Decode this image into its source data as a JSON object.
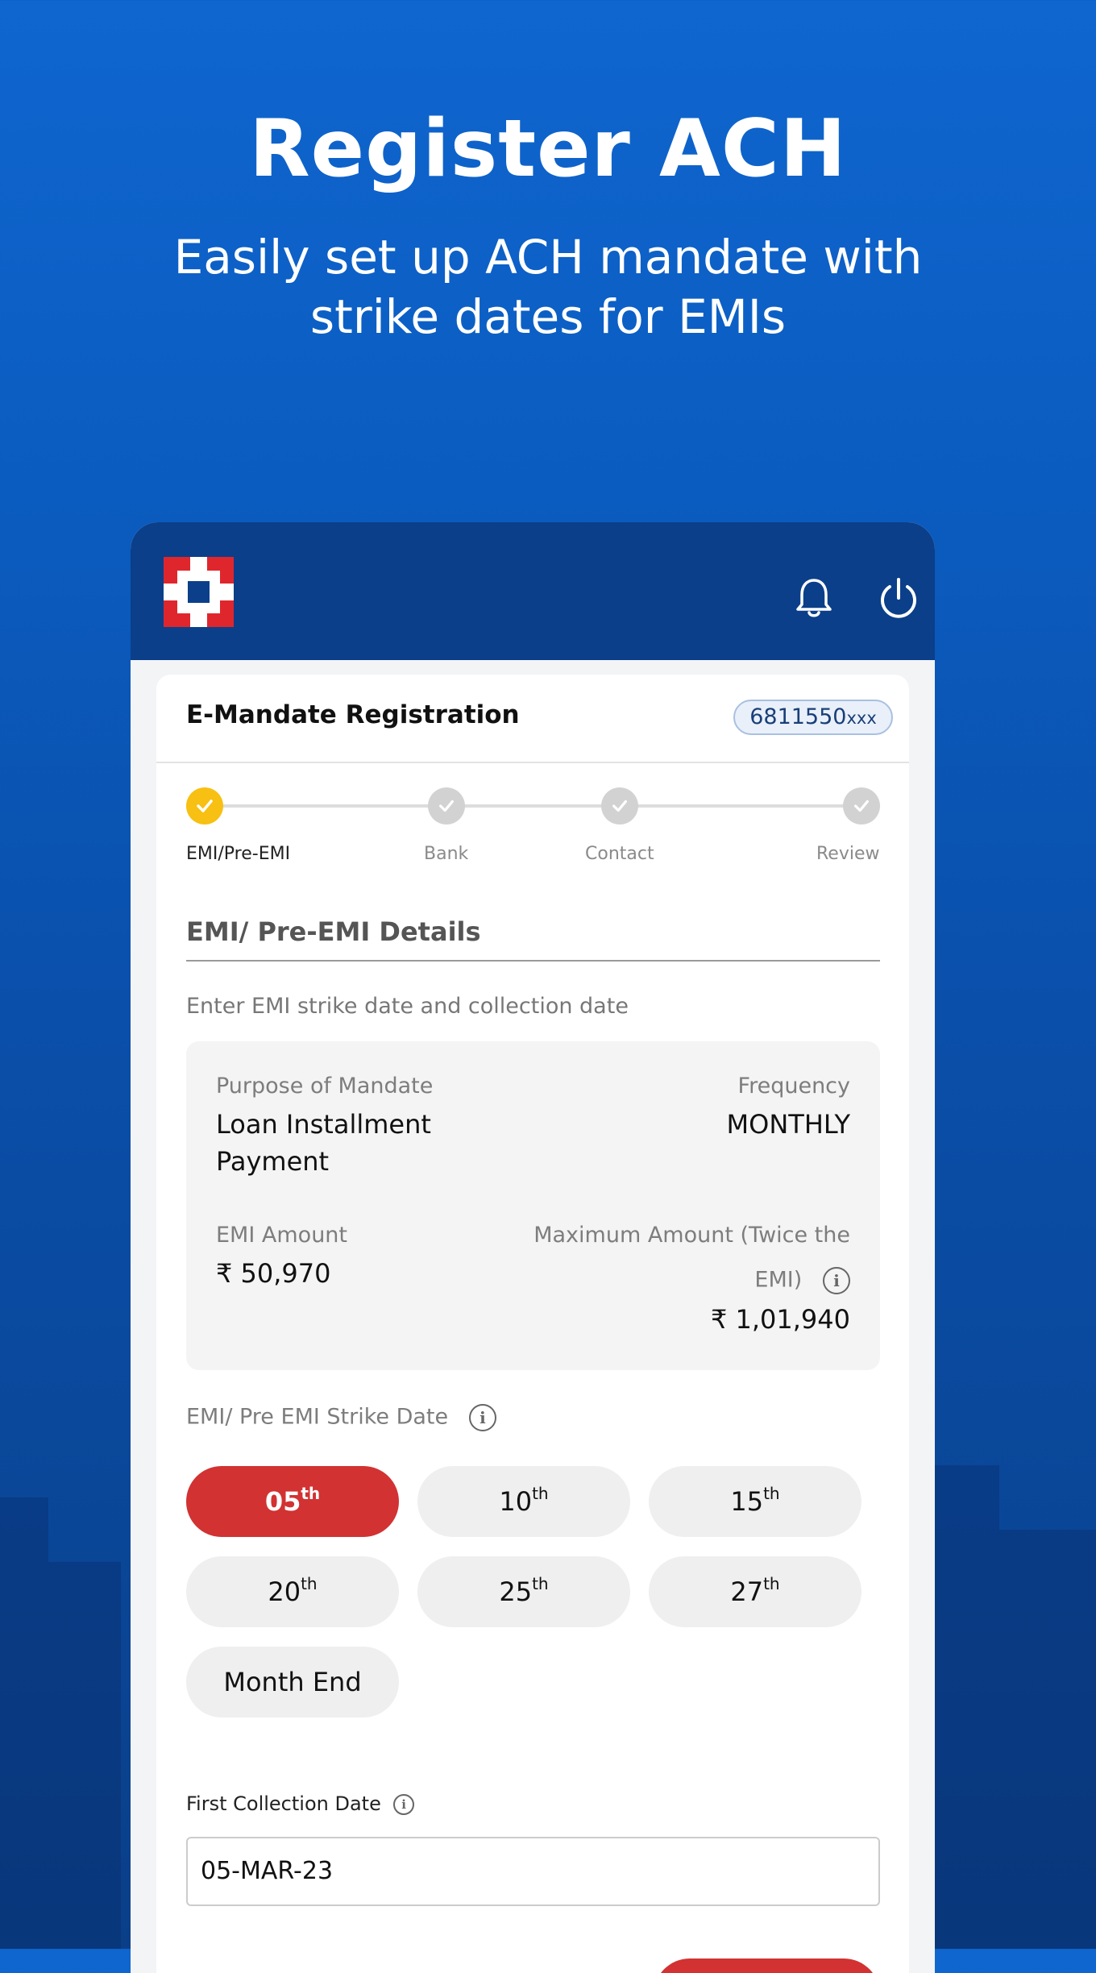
{
  "hero": {
    "title": "Register ACH",
    "subtitle": "Easily set up ACH mandate with strike dates for EMIs"
  },
  "colors": {
    "brand_blue": "#0b3f8a",
    "accent_red": "#d23232",
    "step_active": "#f7c012"
  },
  "header": {
    "icons": [
      "hdfc-logo",
      "bell-icon",
      "power-icon"
    ]
  },
  "card": {
    "title": "E-Mandate Registration",
    "account_main": "6811550",
    "account_suffix": "xxx"
  },
  "stepper": {
    "steps": [
      {
        "label": "EMI/Pre-EMI",
        "state": "active"
      },
      {
        "label": "Bank",
        "state": "done"
      },
      {
        "label": "Contact",
        "state": "done"
      },
      {
        "label": "Review",
        "state": "done"
      }
    ]
  },
  "section": {
    "title": "EMI/ Pre-EMI Details",
    "description": "Enter EMI strike date and collection date"
  },
  "details": {
    "purpose_label": "Purpose of Mandate",
    "purpose_value": "Loan Installment Payment",
    "frequency_label": "Frequency",
    "frequency_value": "MONTHLY",
    "emi_label": "EMI Amount",
    "emi_value": "₹ 50,970",
    "max_label_line1": "Maximum Amount (Twice the",
    "max_label_line2": "EMI)",
    "max_value": "₹ 1,01,940"
  },
  "strike": {
    "label": "EMI/ Pre EMI Strike Date",
    "options": [
      {
        "num": "05",
        "suffix": "th",
        "selected": true
      },
      {
        "num": "10",
        "suffix": "th",
        "selected": false
      },
      {
        "num": "15",
        "suffix": "th",
        "selected": false
      },
      {
        "num": "20",
        "suffix": "th",
        "selected": false
      },
      {
        "num": "25",
        "suffix": "th",
        "selected": false
      },
      {
        "num": "27",
        "suffix": "th",
        "selected": false
      },
      {
        "num": "Month End",
        "suffix": "",
        "selected": false
      }
    ]
  },
  "first_collection": {
    "label": "First Collection Date",
    "value": "05-MAR-23"
  }
}
